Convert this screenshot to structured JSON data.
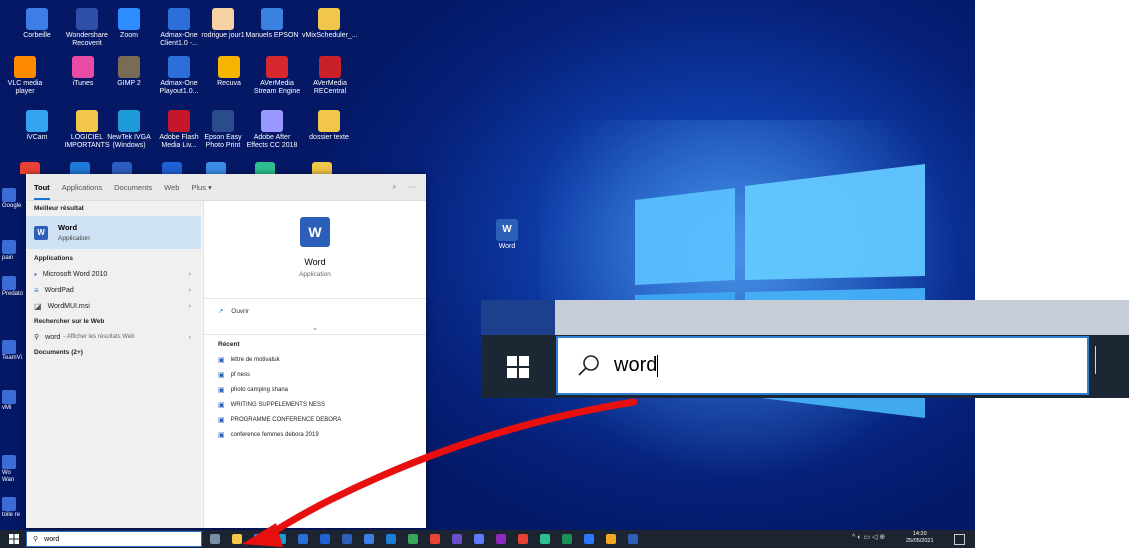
{
  "desktop_icons": [
    {
      "label": "Corbeille",
      "color": "#3c7ee6"
    },
    {
      "label": "Wondershare Recoverit",
      "color": "#2f4ea8"
    },
    {
      "label": "Zoom",
      "color": "#2d8cff"
    },
    {
      "label": "Admax-One Client1.0 -...",
      "color": "#2c6fd8"
    },
    {
      "label": "rodrigue jour1",
      "color": "#f5d1a3"
    },
    {
      "label": "Manuels EPSON",
      "color": "#3b82e0"
    },
    {
      "label": "vMixScheduler_...",
      "color": "#f2c64a"
    },
    {
      "label": "VLC media player",
      "color": "#ff8a00"
    },
    {
      "label": "iTunes",
      "color": "#e94aa5"
    },
    {
      "label": "GIMP 2",
      "color": "#7a6b54"
    },
    {
      "label": "Admax-One Playout1.0...",
      "color": "#2c6fd8"
    },
    {
      "label": "Recuva",
      "color": "#f4b400"
    },
    {
      "label": "AVerMedia Stream Engine",
      "color": "#d7282f"
    },
    {
      "label": "AVerMedia RECentral",
      "color": "#c9202a"
    },
    {
      "label": "iVCam",
      "color": "#36a3f0"
    },
    {
      "label": "LOGICIEL IMPORTANTS",
      "color": "#f2c64a"
    },
    {
      "label": "NewTek IVGA (Windows)",
      "color": "#1e9bd7"
    },
    {
      "label": "Adobe Flash Media Liv...",
      "color": "#c4172c"
    },
    {
      "label": "Epson Easy Photo Print",
      "color": "#2b4c8c"
    },
    {
      "label": "Adobe After Effects CC 2018",
      "color": "#9999ff"
    },
    {
      "label": "dossier texte",
      "color": "#f2c64a"
    }
  ],
  "left_edge_labels": [
    "Google",
    "pain",
    "Predato",
    "TeamVi",
    "vMi",
    "Wo Wan",
    "toile re"
  ],
  "desktop_word_shortcut": "Word",
  "start_menu": {
    "tabs": [
      "Tout",
      "Applications",
      "Documents",
      "Web",
      "Plus ▾"
    ],
    "tail_icons": [
      "feedback-icon",
      "more-icon"
    ],
    "best_match_header": "Meilleur résultat",
    "best_match": {
      "title": "Word",
      "subtitle": "Application"
    },
    "apps_header": "Applications",
    "apps": [
      {
        "label": "Microsoft Word 2010"
      },
      {
        "label": "WordPad"
      },
      {
        "label": "WordMUI.msi"
      }
    ],
    "web_header": "Rechercher sur le Web",
    "web_item": "word",
    "web_suffix": "- Afficher les résultats Web",
    "documents_header": "Documents (2+)",
    "preview_title": "Word",
    "preview_subtitle": "Application",
    "open_label": "Ouvrir",
    "recent_header": "Récent",
    "recent": [
      "lettre de motivatuk",
      "pf ness",
      "photo camping shana",
      "WRITING SUPPELEMENTS NESS",
      "PROGRAMME CONFERENCE DEBORA",
      "conference femmes debora 2019"
    ]
  },
  "taskbar": {
    "search_text": "word",
    "clock_time": "14:20",
    "clock_date": "25/05/2021"
  },
  "zoom_search_text": "word",
  "colors": {
    "accent": "#2e7fd6",
    "arrow": "#e8100f",
    "desktop": "#0b35a0"
  }
}
